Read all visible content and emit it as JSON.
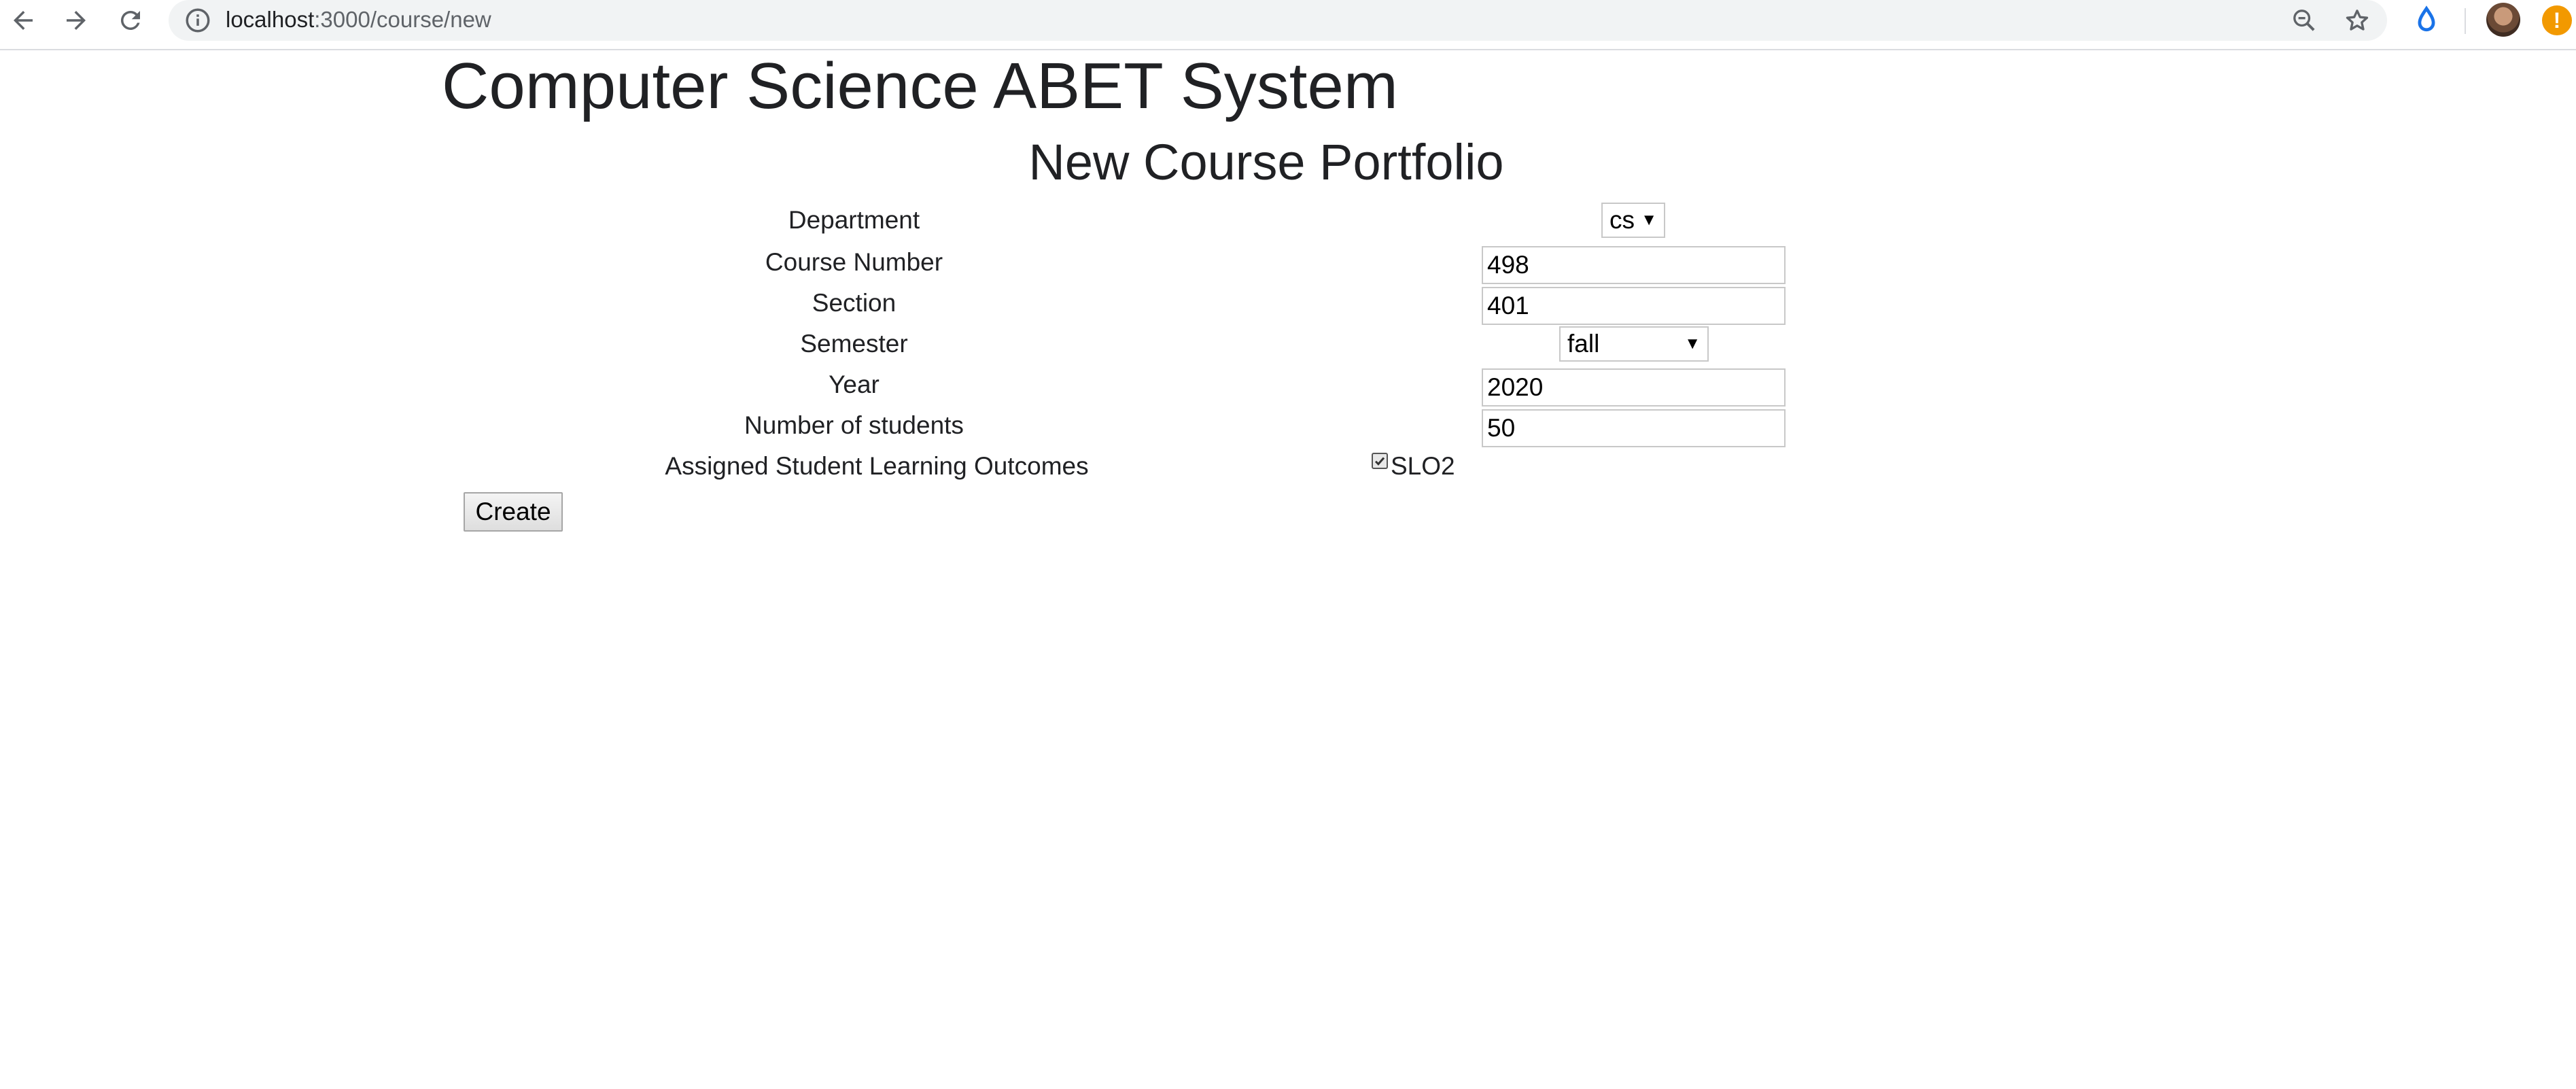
{
  "browser": {
    "url_host": "localhost",
    "url_path": ":3000/course/new"
  },
  "page": {
    "site_title": "Computer Science ABET System",
    "form_title": "New Course Portfolio"
  },
  "form": {
    "department": {
      "label": "Department",
      "value": "cs"
    },
    "course_number": {
      "label": "Course Number",
      "value": "498"
    },
    "section": {
      "label": "Section",
      "value": "401"
    },
    "semester": {
      "label": "Semester",
      "value": "fall"
    },
    "year": {
      "label": "Year",
      "value": "2020"
    },
    "num_students": {
      "label": "Number of students",
      "value": "50"
    },
    "outcomes": {
      "label": "Assigned Student Learning Outcomes",
      "options": [
        {
          "label": "SLO2",
          "checked": true
        }
      ]
    },
    "submit_label": "Create"
  },
  "colors": {
    "alert": "#f29900",
    "extension_drop": "#1a73e8"
  },
  "icons": {
    "back": "back-arrow-icon",
    "forward": "forward-arrow-icon",
    "reload": "reload-icon",
    "info": "info-icon",
    "zoom": "zoom-out-icon",
    "bookmark": "star-icon",
    "extension": "droplet-icon",
    "profile": "avatar",
    "alert": "alert-icon"
  }
}
